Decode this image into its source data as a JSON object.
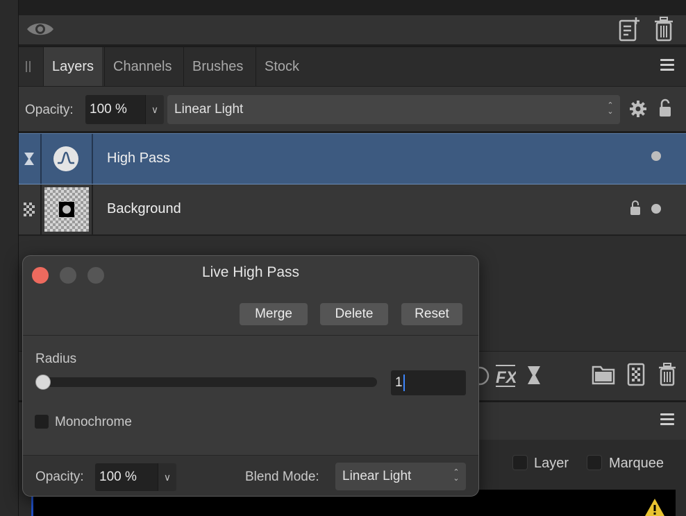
{
  "tabs": {
    "items": [
      "Layers",
      "Channels",
      "Brushes",
      "Stock"
    ],
    "active": "Layers"
  },
  "layer_options": {
    "opacity_label": "Opacity:",
    "opacity_value": "100 %",
    "blend_mode": "Linear Light"
  },
  "layers": [
    {
      "name": "High Pass",
      "selected": true
    },
    {
      "name": "Background",
      "selected": false,
      "locked": true
    }
  ],
  "lower_panel": {
    "layer_label": "Layer",
    "marquee_label": "Marquee"
  },
  "dialog": {
    "title": "Live High Pass",
    "merge_label": "Merge",
    "delete_label": "Delete",
    "reset_label": "Reset",
    "radius_label": "Radius",
    "radius_value": "1",
    "radius_slider_fraction": 0.0,
    "monochrome_label": "Monochrome",
    "opacity_label": "Opacity:",
    "opacity_value": "100 %",
    "blend_mode_label": "Blend Mode:",
    "blend_mode_value": "Linear Light"
  },
  "colors": {
    "selected_row": "#3d5a80",
    "close_button": "#ed6a5e",
    "caret": "#3d86ff"
  }
}
